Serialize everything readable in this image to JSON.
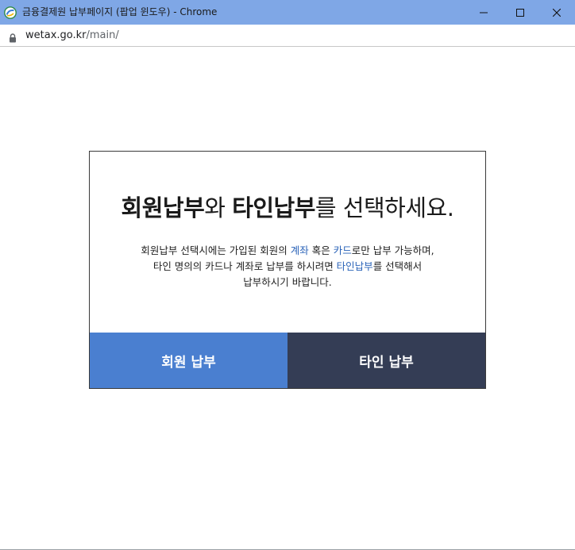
{
  "window": {
    "title": "금융결제원 납부페이지 (팝업 윈도우) - Chrome",
    "icon": "chrome-app-icon"
  },
  "address": {
    "host": "wetax.go.kr",
    "path": "/main/",
    "secure_icon": "lock-icon"
  },
  "dialog": {
    "headline": {
      "part1": "회원납부",
      "part2": "와 ",
      "part3": "타인납부",
      "part4": "를 선택하세요."
    },
    "description": {
      "line1_a": "회원납부 선택시에는 가입된 회원의 ",
      "line1_b": "계좌",
      "line1_c": " 혹은 ",
      "line1_d": "카드",
      "line1_e": "로만 납부 가능하며,",
      "line2_a": "타인 명의의 카드나 계좌로 납부를 하시려면 ",
      "line2_b": "타인납부",
      "line2_c": "를 선택해서",
      "line3": "납부하시기 바랍니다."
    },
    "buttons": {
      "member": "회원 납부",
      "other": "타인 납부"
    }
  },
  "colors": {
    "titlebar": "#7fa7e6",
    "member_button": "#4a7fd0",
    "other_button": "#343d55",
    "highlight": "#2a63b8"
  }
}
